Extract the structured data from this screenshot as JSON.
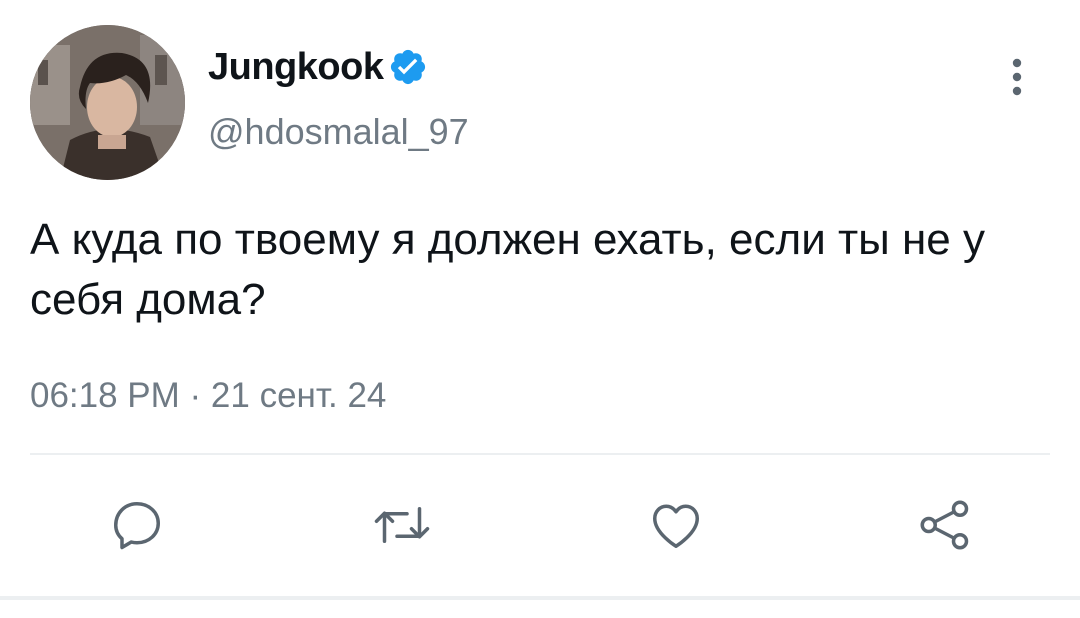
{
  "tweet": {
    "author": {
      "display_name": "Jungkook",
      "handle": "@hdosmalal_97",
      "verified": true
    },
    "text": "А куда по твоему я должен ехать, если ты не у себя дома?",
    "timestamp": "06:18 PM · 21 сент. 24"
  },
  "actions": [
    {
      "icon": "reply-icon"
    },
    {
      "icon": "retweet-icon"
    },
    {
      "icon": "like-icon"
    },
    {
      "icon": "share-icon"
    }
  ],
  "colors": {
    "text_primary": "#0f1419",
    "text_secondary": "#6f7a84",
    "verified_blue": "#1d9bf0",
    "icon_gray": "#5b6670",
    "divider": "#eceff1"
  }
}
